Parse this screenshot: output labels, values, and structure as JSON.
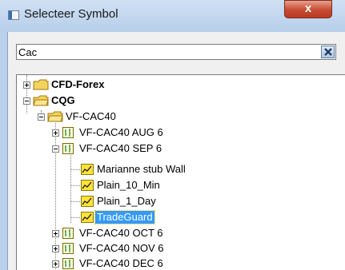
{
  "window": {
    "title": "Selecteer Symbol",
    "close_label": "x"
  },
  "search": {
    "value": "Cac"
  },
  "tree": {
    "cfd_forex": "CFD-Forex",
    "cqg": "CQG",
    "vf_cac40": "VF-CAC40",
    "items": [
      "VF-CAC40 AUG 6",
      "VF-CAC40 SEP 6",
      "Marianne stub Wall",
      "Plain_10_Min",
      "Plain_1_Day",
      "TradeGuard",
      "VF-CAC40 OCT 6",
      "VF-CAC40 NOV 6",
      "VF-CAC40 DEC 6"
    ]
  },
  "colors": {
    "selection": "#3399ff",
    "folder": "#f3d35c",
    "close": "#c74a31"
  }
}
